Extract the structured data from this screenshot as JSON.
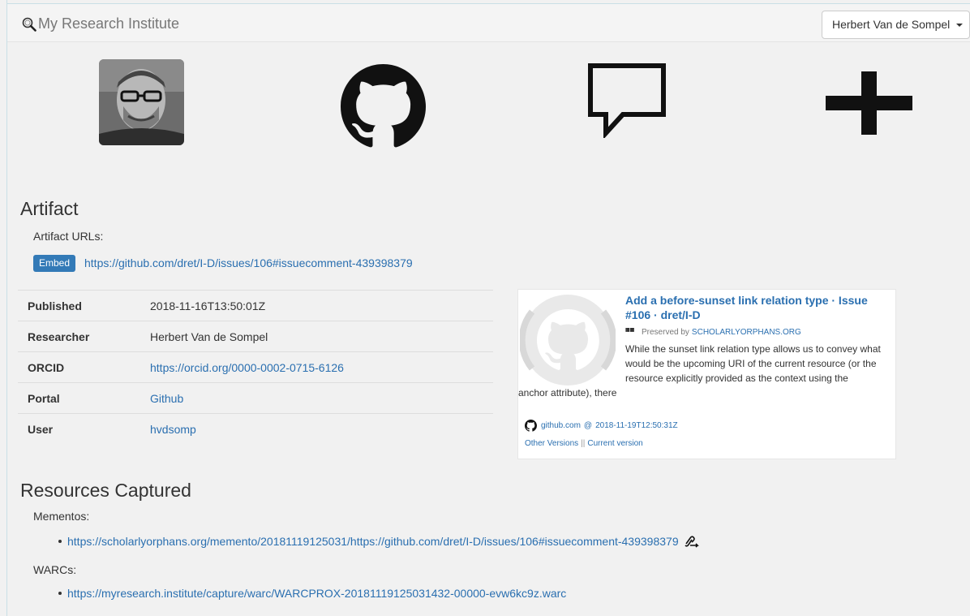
{
  "navbar": {
    "brand": "My Research Institute",
    "user_menu": "Herbert Van de Sompel"
  },
  "icons": {
    "avatar": "researcher-avatar",
    "portal": "github-icon",
    "comment": "speech-bubble-icon",
    "add": "plus-icon"
  },
  "artifact": {
    "heading": "Artifact",
    "urls_label": "Artifact URLs:",
    "embed_label": "Embed",
    "url": "https://github.com/dret/I-D/issues/106#issuecomment-439398379",
    "rows": [
      {
        "key": "Published",
        "value": "2018-11-16T13:50:01Z"
      },
      {
        "key": "Researcher",
        "value": "Herbert Van de Sompel"
      },
      {
        "key": "ORCID",
        "value": "https://orcid.org/0000-0002-0715-6126"
      },
      {
        "key": "Portal",
        "value": "Github"
      },
      {
        "key": "User",
        "value": "hvdsomp"
      }
    ]
  },
  "card": {
    "title": "Add a before-sunset link relation type · Issue #106 · dret/I-D",
    "preserved_by_label": "Preserved by",
    "preserved_by": "SCHOLARLYORPHANS.ORG",
    "description_line1": "While the sunset link relation type allows us to convey what",
    "description_line2": "would be the upcoming URI of the current resource (or the",
    "description_line3": "resource explicitly provided as the context using the",
    "description_line4": "anchor attribute), there",
    "site": "github.com",
    "at": "@",
    "datetime": "2018-11-19T12:50:31Z",
    "other_versions": "Other Versions",
    "separator": "||",
    "current_version": "Current version"
  },
  "resources": {
    "heading": "Resources Captured",
    "mementos_label": "Mementos:",
    "memento_url": "https://scholarlyorphans.org/memento/20181119125031/https://github.com/dret/I-D/issues/106#issuecomment-439398379",
    "warcs_label": "WARCs:",
    "warc_url": "https://myresearch.institute/capture/warc/WARCPROX-20181119125031432-00000-evw6kc9z.warc"
  },
  "colors": {
    "link": "#2a6fb0",
    "badge": "#337ab7",
    "background": "#f1f1f1"
  }
}
